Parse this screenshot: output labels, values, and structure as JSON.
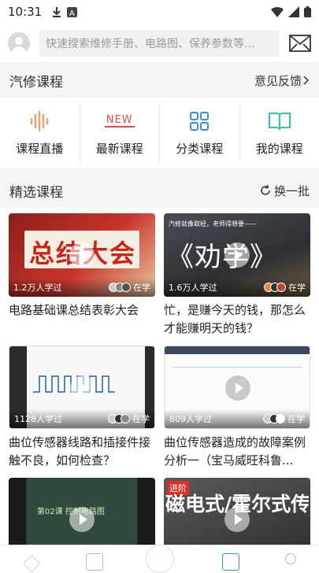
{
  "status": {
    "time": "10:31"
  },
  "search": {
    "placeholder": "快速搜索维修手册、电路图、保养参数等..."
  },
  "section": {
    "title": "汽修课程",
    "feedback": "意见反馈"
  },
  "quick": [
    {
      "label": "课程直播",
      "icon": "live-audio-icon"
    },
    {
      "label": "最新课程",
      "icon": "new-badge-icon",
      "badge": "NEW"
    },
    {
      "label": "分类课程",
      "icon": "grid-icon"
    },
    {
      "label": "我的课程",
      "icon": "book-icon"
    }
  ],
  "featured": {
    "title": "精选课程",
    "refresh": "换一批"
  },
  "courses": [
    {
      "count": "1.2万人学过",
      "status": "在学",
      "title": "电路基础课总结表彰大会",
      "thumb_text": "总结大会"
    },
    {
      "count": "1.6万人学过",
      "status": "在学",
      "title": "忙，是赚今天的钱，那怎么才能赚明天的钱？",
      "thumb_text": "《劝学》",
      "thumb_caption": "汽修就像取经，老师得想要——"
    },
    {
      "count": "1128人学过",
      "status": "在学",
      "title": "曲位传感器线路和插接件接触不良，如何检查？"
    },
    {
      "count": "809人学过",
      "status": "在学",
      "title": "曲位传感器造成的故障案例分析一（宝马威旺科鲁..."
    },
    {
      "count": "",
      "status": "",
      "title": "",
      "thumb_text": "第02课 控制电路图"
    },
    {
      "count": "",
      "status": "",
      "title": "",
      "thumb_text": "磁电式/霍尔式传感器",
      "tag": "进阶"
    }
  ],
  "colors": {
    "accent": "#3a8fd6",
    "orange": "#e8863a",
    "red": "#d9302c"
  }
}
